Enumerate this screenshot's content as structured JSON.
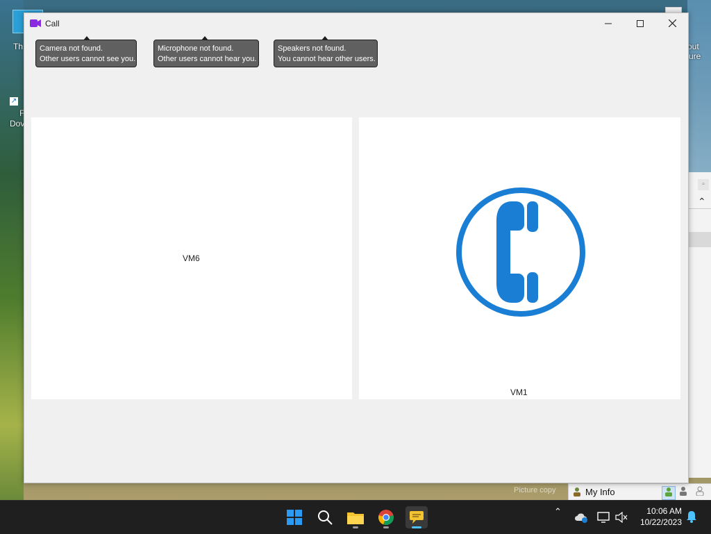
{
  "window": {
    "title": "Call",
    "controls": {
      "minimize": "–",
      "maximize": "☐",
      "close": "✕"
    }
  },
  "notifications": [
    {
      "line1": "Camera not found.",
      "line2": "Other users cannot see you."
    },
    {
      "line1": "Microphone not found.",
      "line2": "Other users cannot hear you."
    },
    {
      "line1": "Speakers not found.",
      "line2": "You cannot hear other users."
    }
  ],
  "panels": {
    "left": {
      "participant": "VM6"
    },
    "right": {
      "participant": "VM1",
      "icon": "phone-icon"
    }
  },
  "desktop": {
    "icon_label_top": "Th",
    "icon_label_left_1": "F",
    "icon_label_left_2": "Dov",
    "icon_label_right_1": "out",
    "icon_label_right_2": "ure",
    "wallpaper_caption": "Picture copy"
  },
  "myinfo": {
    "label": "My Info"
  },
  "taskbar": {
    "apps": [
      "windows-start-icon",
      "search-icon",
      "file-explorer-icon",
      "chrome-icon",
      "chat-app-icon"
    ],
    "clock_time": "10:06 AM",
    "clock_date": "10/22/2023"
  },
  "colors": {
    "accent_blue": "#1a7fd4",
    "tooltip_bg": "#606060",
    "window_bg": "#f0f0f0",
    "taskbar_bg": "#1f1f1f"
  }
}
